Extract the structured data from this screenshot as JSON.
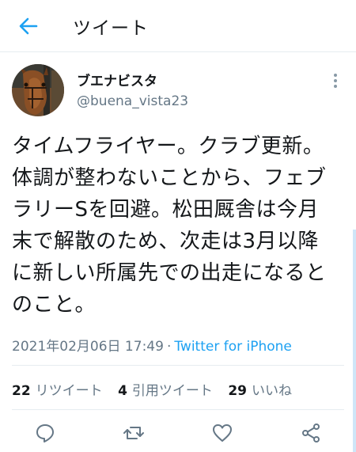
{
  "header": {
    "title": "ツイート",
    "back_icon": "arrow-left-icon",
    "accent_color": "#1da1f2"
  },
  "author": {
    "display_name": "ブエナビスタ",
    "username": "@buena_vista23",
    "avatar_icon": "horse-avatar"
  },
  "tweet": {
    "lines": [
      "タイムフライヤー。クラブ更新。",
      "体調が整わないことから、フェブ",
      "ラリーSを回避。松田厩舎は今月",
      "末で解散のため、次走は3月以降",
      "に新しい所属先での出走になると",
      "のこと。"
    ],
    "timestamp": "2021年02月06日 17:49",
    "separator": "·",
    "source": "Twitter for iPhone"
  },
  "stats": {
    "retweets_count": "22",
    "retweets_label": "リツイート",
    "quotes_count": "4",
    "quotes_label": "引用ツイート",
    "likes_count": "29",
    "likes_label": "いいね"
  },
  "actions": {
    "icons": [
      "reply-icon",
      "retweet-icon",
      "like-icon",
      "share-icon"
    ]
  }
}
